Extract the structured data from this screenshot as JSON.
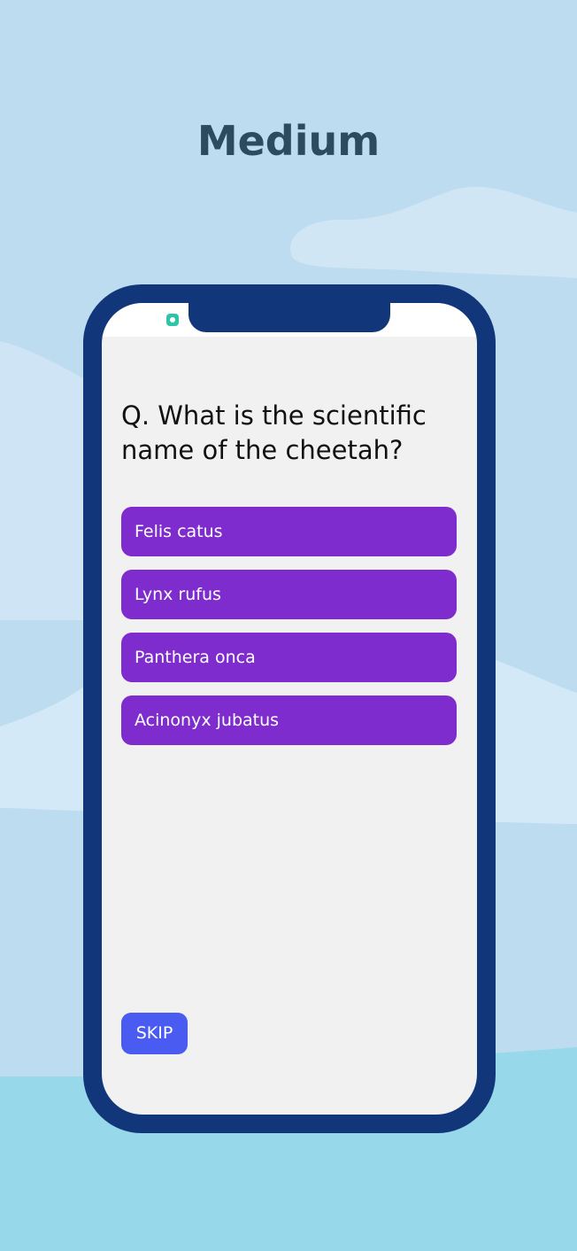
{
  "header": {
    "difficulty": "Medium"
  },
  "status_bar": {
    "icon": "app-notification-icon"
  },
  "quiz": {
    "question": "Q. What is the scientific name of the cheetah?",
    "options": [
      {
        "label": "Felis catus"
      },
      {
        "label": "Lynx rufus"
      },
      {
        "label": "Panthera onca"
      },
      {
        "label": "Acinonyx jubatus"
      }
    ],
    "skip_label": "SKIP"
  },
  "colors": {
    "background_sky": "#bddcf0",
    "cloud": "#d6eaf7",
    "ground": "#97d8ea",
    "phone_frame": "#12367a",
    "screen": "#f1f1f1",
    "option_button": "#7e2ccd",
    "skip_button": "#4a5bf1",
    "title_text": "#2a4c5e"
  }
}
